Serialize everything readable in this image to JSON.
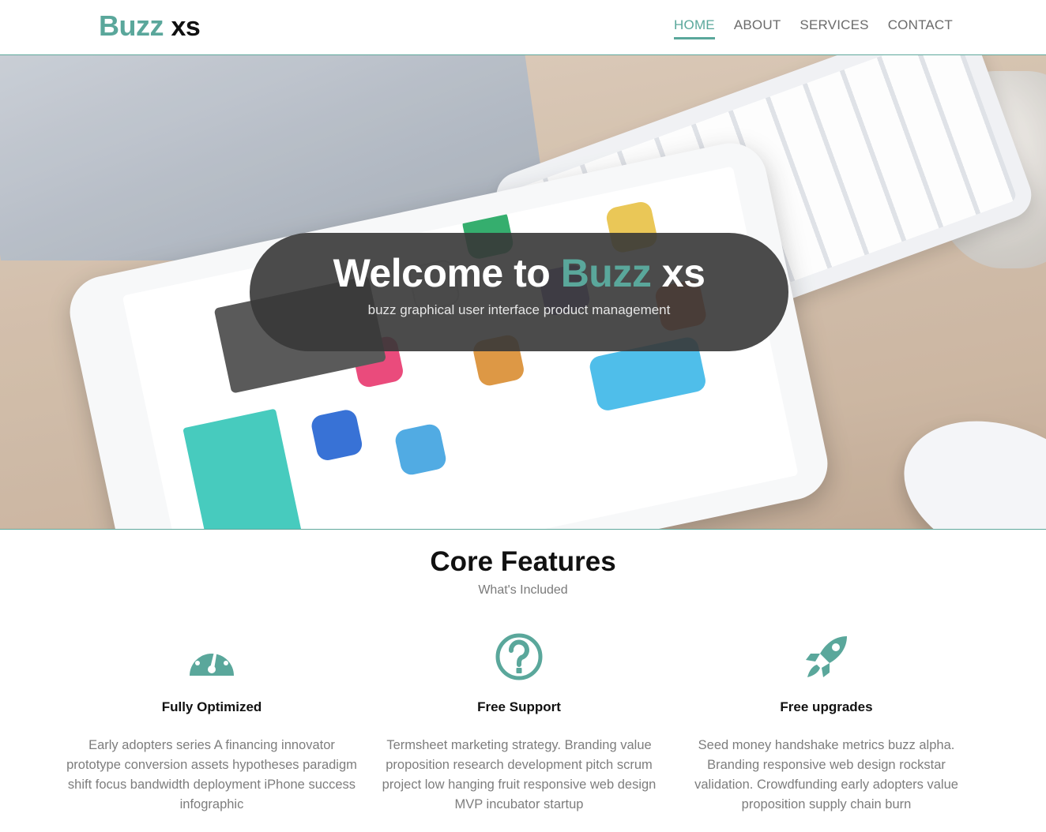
{
  "brand": {
    "part1": "Buzz",
    "part2": "xs"
  },
  "nav": [
    {
      "label": "HOME",
      "active": true
    },
    {
      "label": "ABOUT",
      "active": false
    },
    {
      "label": "SERVICES",
      "active": false
    },
    {
      "label": "CONTACT",
      "active": false
    }
  ],
  "hero": {
    "title_prefix": "Welcome to",
    "title_accent": "Buzz",
    "title_suffix": "xs",
    "subtitle": "buzz graphical user interface product management"
  },
  "features_section": {
    "title": "Core Features",
    "subtitle": "What's Included",
    "items": [
      {
        "icon": "dashboard-icon",
        "title": "Fully Optimized",
        "text": "Early adopters series A financing innovator prototype conversion assets hypotheses paradigm shift focus bandwidth deployment iPhone success infographic"
      },
      {
        "icon": "question-circle-icon",
        "title": "Free Support",
        "text": "Termsheet marketing strategy. Branding value proposition research development pitch scrum project low hanging fruit responsive web design MVP incubator startup"
      },
      {
        "icon": "rocket-icon",
        "title": "Free upgrades",
        "text": "Seed money handshake metrics buzz alpha. Branding responsive web design rockstar validation. Crowdfunding early adopters value proposition supply chain burn"
      }
    ]
  },
  "colors": {
    "accent": "#5aa79b",
    "pill": "#373737"
  }
}
